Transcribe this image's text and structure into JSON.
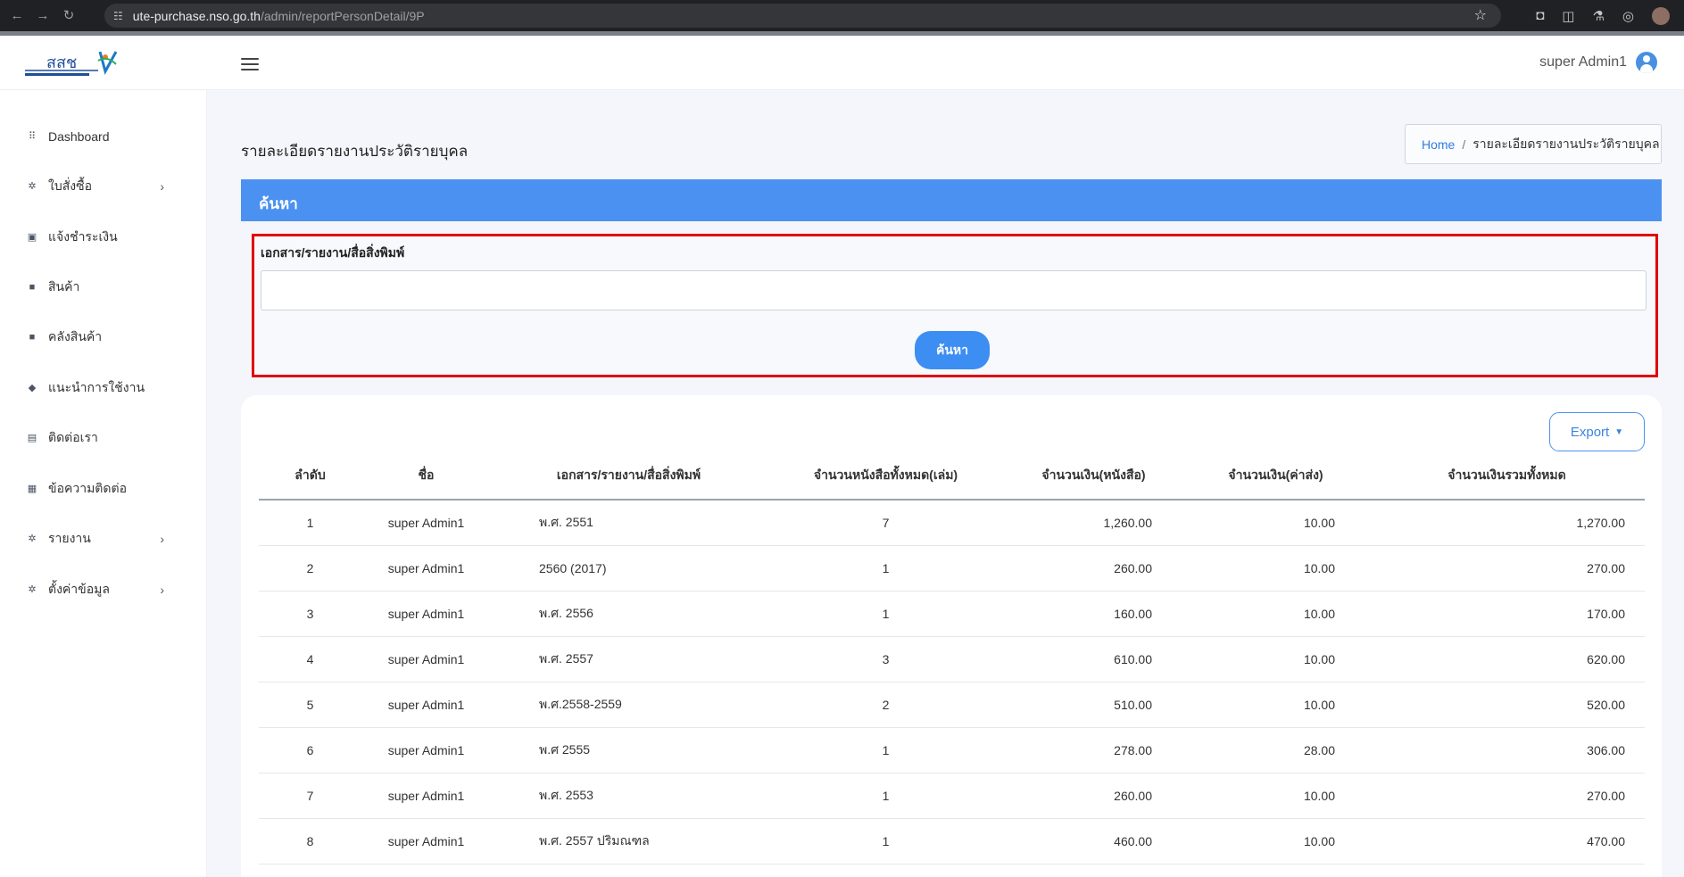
{
  "browser": {
    "url_host": "ute-purchase.nso.go.th",
    "url_path": "/admin/reportPersonDetail/9P"
  },
  "header": {
    "logo_text": "สสช",
    "user_name": "super Admin1"
  },
  "sidebar": {
    "items": [
      {
        "label": "Dashboard",
        "icon": "grid-icon",
        "has_submenu": false
      },
      {
        "label": "ใบสั่งซื้อ",
        "icon": "gear-icon",
        "has_submenu": true
      },
      {
        "label": "แจ้งชำระเงิน",
        "icon": "money-icon",
        "has_submenu": false
      },
      {
        "label": "สินค้า",
        "icon": "bag-icon",
        "has_submenu": false
      },
      {
        "label": "คลังสินค้า",
        "icon": "bag-icon",
        "has_submenu": false
      },
      {
        "label": "แนะนำการใช้งาน",
        "icon": "box-icon",
        "has_submenu": false
      },
      {
        "label": "ติดต่อเรา",
        "icon": "id-card-icon",
        "has_submenu": false
      },
      {
        "label": "ข้อความติดต่อ",
        "icon": "document-icon",
        "has_submenu": false
      },
      {
        "label": "รายงาน",
        "icon": "gear-icon",
        "has_submenu": true
      },
      {
        "label": "ตั้งค่าข้อมูล",
        "icon": "gear-icon",
        "has_submenu": true
      }
    ]
  },
  "page": {
    "title": "รายละเอียดรายงานประวัติรายบุคล",
    "breadcrumb": {
      "home": "Home",
      "separator": "/",
      "current": "รายละเอียดรายงานประวัติรายบุคล"
    }
  },
  "search": {
    "header": "ค้นหา",
    "label": "เอกสาร/รายงาน/สื่อสิ่งพิมพ์",
    "value": "",
    "placeholder": "",
    "button": "ค้นหา"
  },
  "report": {
    "export_label": "Export",
    "columns": [
      "ลำดับ",
      "ชื่อ",
      "เอกสาร/รายงาน/สื่อสิ่งพิมพ์",
      "จำนวนหนังสือทั้งหมด(เล่ม)",
      "จำนวนเงิน(หนังสือ)",
      "จำนวนเงิน(ค่าส่ง)",
      "จำนวนเงินรวมทั้งหมด"
    ],
    "rows": [
      [
        "1",
        "super Admin1",
        "พ.ศ. 2551",
        "7",
        "1,260.00",
        "10.00",
        "1,270.00"
      ],
      [
        "2",
        "super Admin1",
        "2560 (2017)",
        "1",
        "260.00",
        "10.00",
        "270.00"
      ],
      [
        "3",
        "super Admin1",
        "พ.ศ. 2556",
        "1",
        "160.00",
        "10.00",
        "170.00"
      ],
      [
        "4",
        "super Admin1",
        "พ.ศ. 2557",
        "3",
        "610.00",
        "10.00",
        "620.00"
      ],
      [
        "5",
        "super Admin1",
        "พ.ศ.2558-2559",
        "2",
        "510.00",
        "10.00",
        "520.00"
      ],
      [
        "6",
        "super Admin1",
        "พ.ศ 2555",
        "1",
        "278.00",
        "28.00",
        "306.00"
      ],
      [
        "7",
        "super Admin1",
        "พ.ศ. 2553",
        "1",
        "260.00",
        "10.00",
        "270.00"
      ],
      [
        "8",
        "super Admin1",
        "พ.ศ. 2557 ปริมณฑล",
        "1",
        "460.00",
        "10.00",
        "470.00"
      ]
    ]
  },
  "colors": {
    "primary": "#4b91f1",
    "highlight_border": "#e00000",
    "browser_bg": "#202124"
  }
}
